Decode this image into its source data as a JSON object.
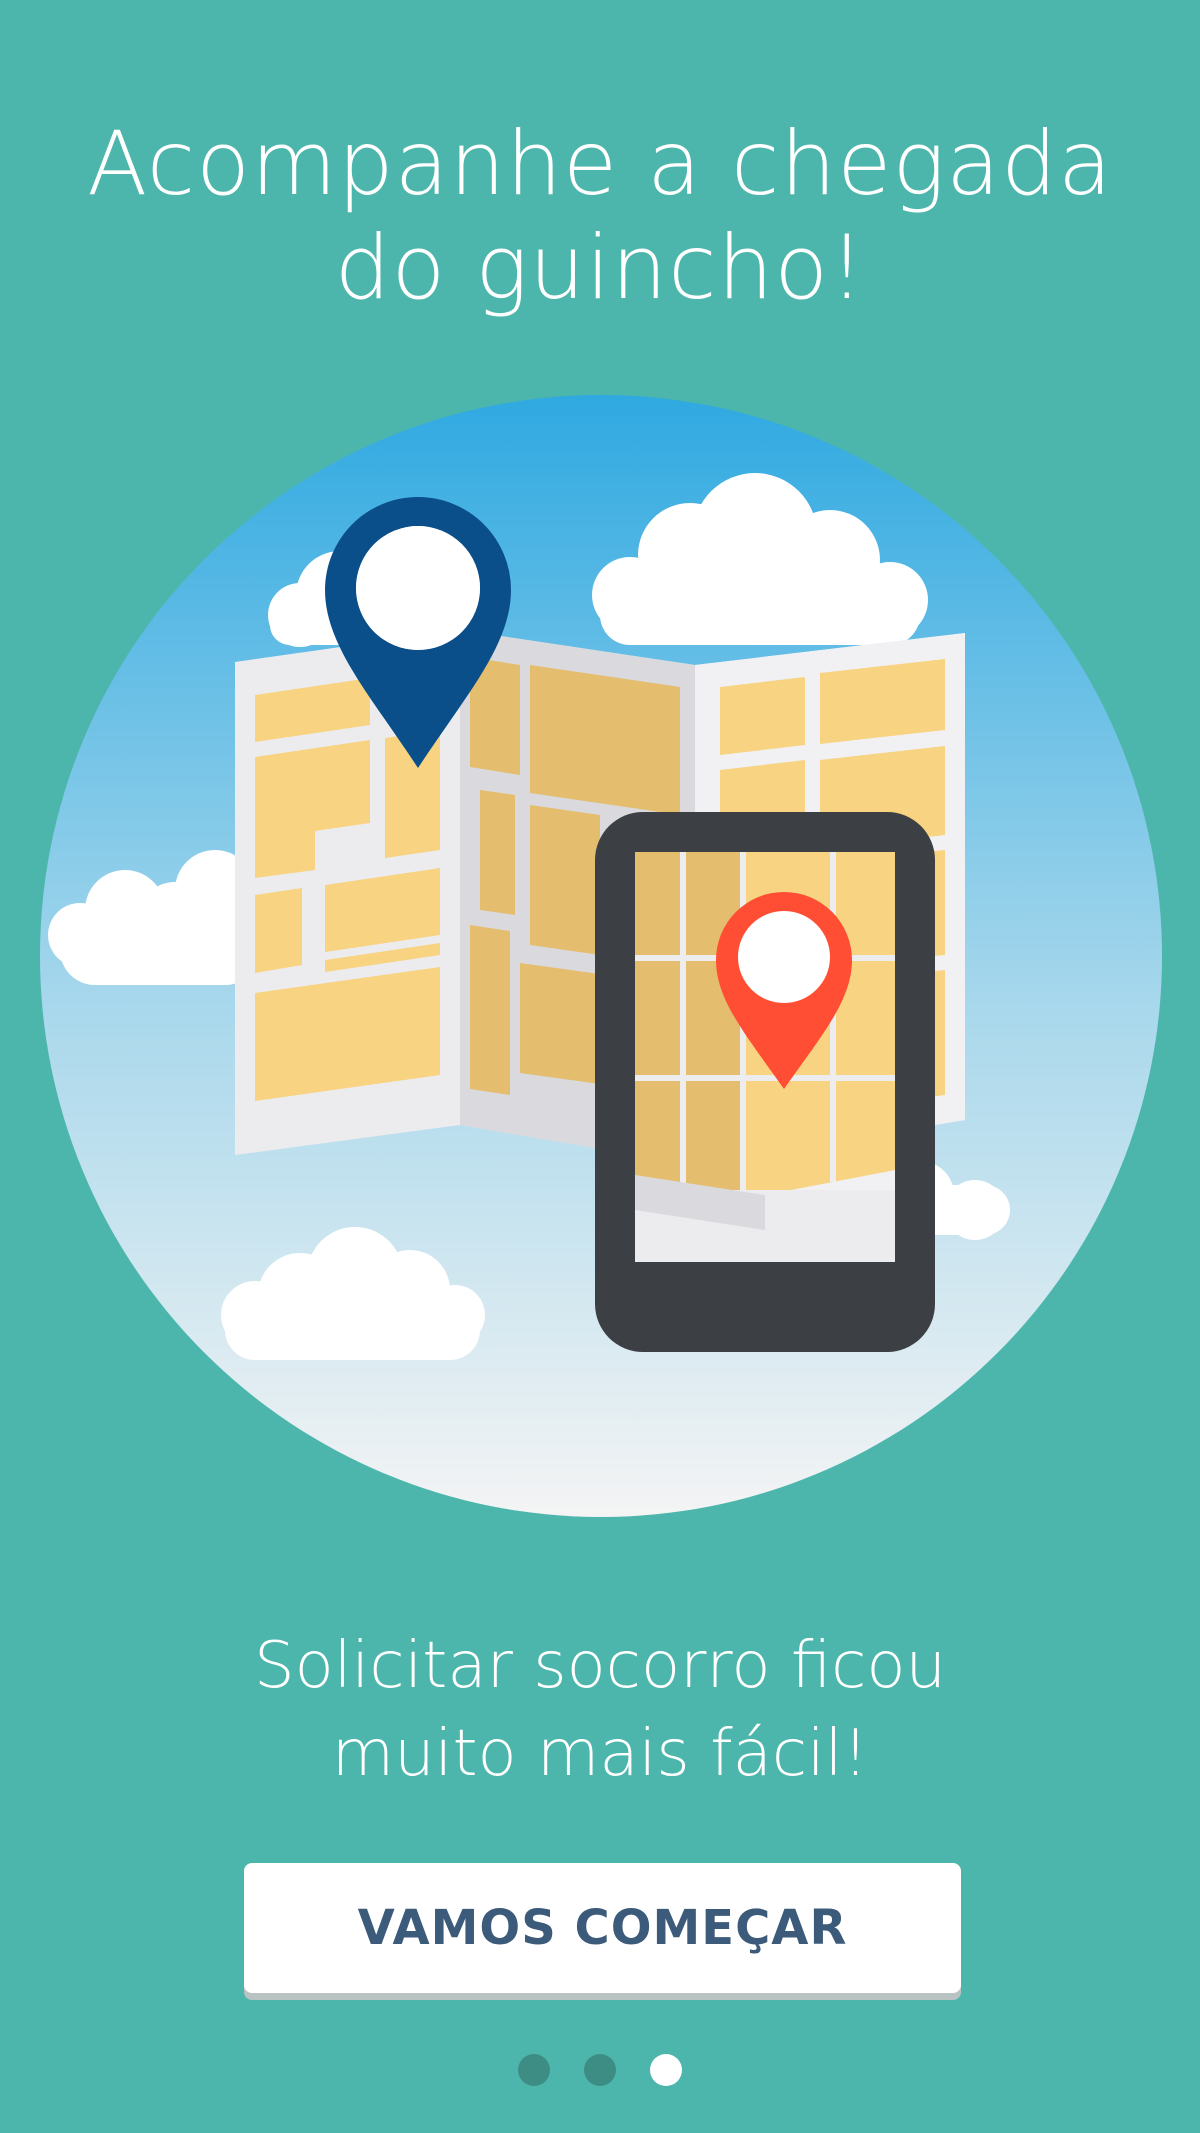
{
  "headline": {
    "line1": "Acompanhe a chegada",
    "line2": "do guincho!"
  },
  "subline": {
    "line1": "Solicitar socorro ficou",
    "line2": "muito mais fácil!"
  },
  "cta": {
    "label": "VAMOS COMEÇAR"
  },
  "pagination": {
    "total": 3,
    "active_index": 3
  },
  "colors": {
    "background": "#4DB6AC",
    "button_text": "#3C5A7A",
    "pin_primary": "#0B4F8A",
    "pin_secondary": "#FF4E33",
    "phone_body": "#3C4044",
    "map_block": "#F7D382"
  },
  "icons": {
    "destination_pin": "map-pin-icon",
    "phone_pin": "map-pin-icon",
    "phone": "smartphone-icon",
    "map": "folded-map-icon"
  }
}
